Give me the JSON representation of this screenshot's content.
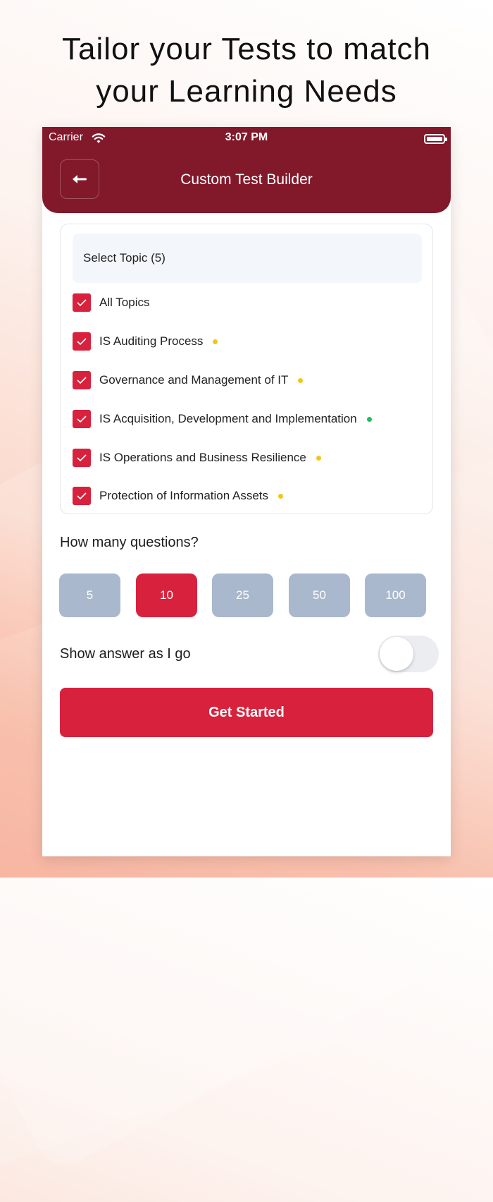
{
  "headline": {
    "line1": "Tailor your Tests to match",
    "line2": "your Learning Needs"
  },
  "status_bar": {
    "carrier": "Carrier",
    "time": "3:07 PM",
    "icons": [
      "wifi-icon",
      "battery-icon"
    ]
  },
  "header": {
    "title": "Custom Test Builder",
    "back_icon": "arrow-left-icon"
  },
  "topics": {
    "select_label": "Select Topic (5)",
    "items": [
      {
        "label": "All Topics",
        "checked": true,
        "dot": null
      },
      {
        "label": "IS Auditing Process",
        "checked": true,
        "dot": "#f5c518"
      },
      {
        "label": "Governance and Management of IT",
        "checked": true,
        "dot": "#f5c518"
      },
      {
        "label": "IS Acquisition, Development and Implementation",
        "checked": true,
        "dot": "#1fbf5c"
      },
      {
        "label": "IS Operations and Business Resilience",
        "checked": true,
        "dot": "#f5c518"
      },
      {
        "label": "Protection of Information Assets",
        "checked": true,
        "dot": "#f5c518"
      }
    ]
  },
  "questions": {
    "heading": "How many questions?",
    "options": [
      "5",
      "10",
      "25",
      "50",
      "100"
    ],
    "selected": "10"
  },
  "show_answer": {
    "label": "Show answer as I go",
    "enabled": false
  },
  "cta": {
    "label": "Get Started"
  },
  "colors": {
    "brand": "#82192b",
    "accent": "#d8223d",
    "inactive": "#a9b8cc"
  }
}
